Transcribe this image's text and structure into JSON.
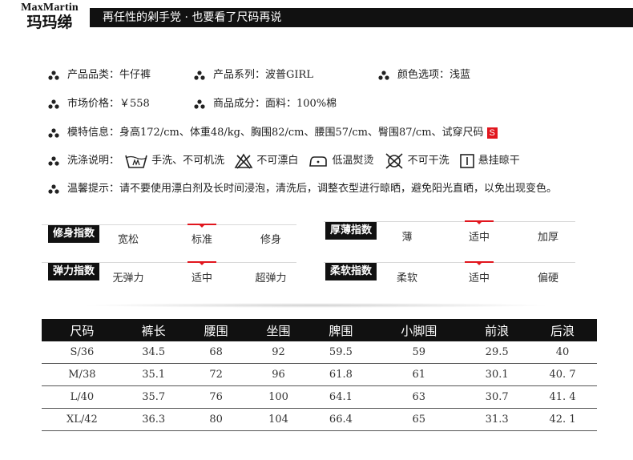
{
  "brand": {
    "en": "MaxMartin",
    "cn": "玛玛绨"
  },
  "header": {
    "title": "再任性的剁手党 · 也要看了尺码再说"
  },
  "info": {
    "category_label": "产品品类：",
    "category_value": "牛仔裤",
    "series_label": "产品系列：",
    "series_value": "波普GIRL",
    "color_label": "颜色选项：",
    "color_value": "浅蓝",
    "price_label": "市场价格：",
    "price_value": "￥558",
    "material_label": "商品成分：",
    "material_value": "面料：100%棉",
    "model_label": "模特信息：",
    "model_value": "身高172/cm、体重48/kg、胸围82/cm、腰围57/cm、臀围87/cm、试穿尺码",
    "model_size": "S",
    "wash_label": "洗涤说明：",
    "wash_1": "手洗、不可机洗",
    "wash_2": "不可漂白",
    "wash_3": "低温熨烫",
    "wash_4": "不可干洗",
    "wash_5": "悬挂晾干",
    "tip_label": "温馨提示：",
    "tip_value": "请不要使用漂白剂及长时间浸泡，清洗后，调整衣型进行晾晒，避免阳光直晒，以免出现变色。"
  },
  "indices": [
    {
      "label": "修身指数",
      "options": [
        "宽松",
        "标准",
        "修身"
      ],
      "selected_index": 1
    },
    {
      "label": "厚薄指数",
      "options": [
        "薄",
        "适中",
        "加厚"
      ],
      "selected_index": 1
    },
    {
      "label": "弹力指数",
      "options": [
        "无弹力",
        "适中",
        "超弹力"
      ],
      "selected_index": 1
    },
    {
      "label": "柔软指数",
      "options": [
        "柔软",
        "适中",
        "偏硬"
      ],
      "selected_index": 1
    }
  ],
  "table": {
    "headers": [
      "尺码",
      "裤长",
      "腰围",
      "坐围",
      "脾围",
      "小脚围",
      "前浪",
      "后浪"
    ],
    "rows": [
      [
        "S/36",
        "34.5",
        "68",
        "92",
        "59.5",
        "59",
        "29.5",
        "40"
      ],
      [
        "M/38",
        "35.1",
        "72",
        "96",
        "61.8",
        "61",
        "30.1",
        "40. 7"
      ],
      [
        "L/40",
        "35.7",
        "76",
        "100",
        "64.1",
        "63",
        "30.7",
        "41. 4"
      ],
      [
        "XL/42",
        "36.3",
        "80",
        "104",
        "66.4",
        "65",
        "31.3",
        "42. 1"
      ]
    ]
  },
  "colors": {
    "accent": "#e1161e",
    "dark": "#111111"
  }
}
